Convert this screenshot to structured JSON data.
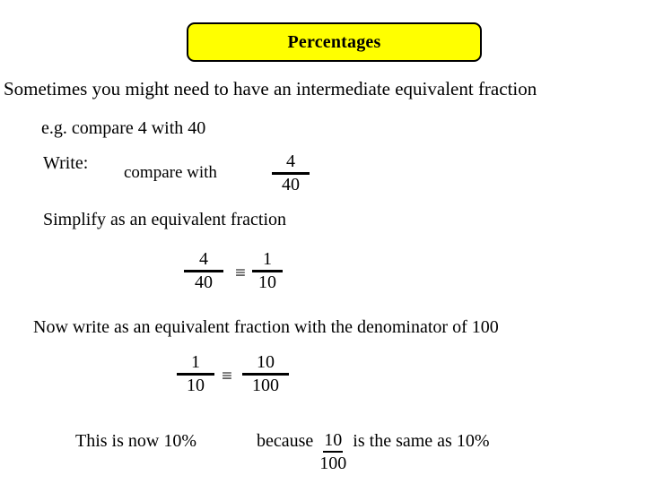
{
  "slide": {
    "title": "Percentages",
    "title_bg": "#ffff00",
    "title_border": "#000000",
    "background": "#ffffff",
    "text_color": "#000000"
  },
  "body": {
    "intro": "Sometimes you might need to have an intermediate equivalent  fraction",
    "example": "e.g. compare  4 with 40",
    "write_label": "Write:",
    "compare_with": "compare with",
    "simplify": "Simplify as an equivalent fraction",
    "now_write": "Now write as an equivalent fraction with the denominator of 100",
    "conclusion": "This is now 10%",
    "because_prefix": "because",
    "because_suffix": "is the same as 10%"
  },
  "fractions": {
    "four_fortieths": {
      "numerator": "4",
      "denominator": "40"
    },
    "four_fortieths_b": {
      "numerator": "4",
      "denominator": "40"
    },
    "one_tenth": {
      "numerator": "1",
      "denominator": "10"
    },
    "one_tenth_b": {
      "numerator": "1",
      "denominator": "10"
    },
    "ten_hundredths": {
      "numerator": "10",
      "denominator": "100"
    },
    "ten_hundredths_inline": {
      "numerator": "10",
      "denominator": "100"
    }
  },
  "symbols": {
    "equivalent": "≡"
  }
}
